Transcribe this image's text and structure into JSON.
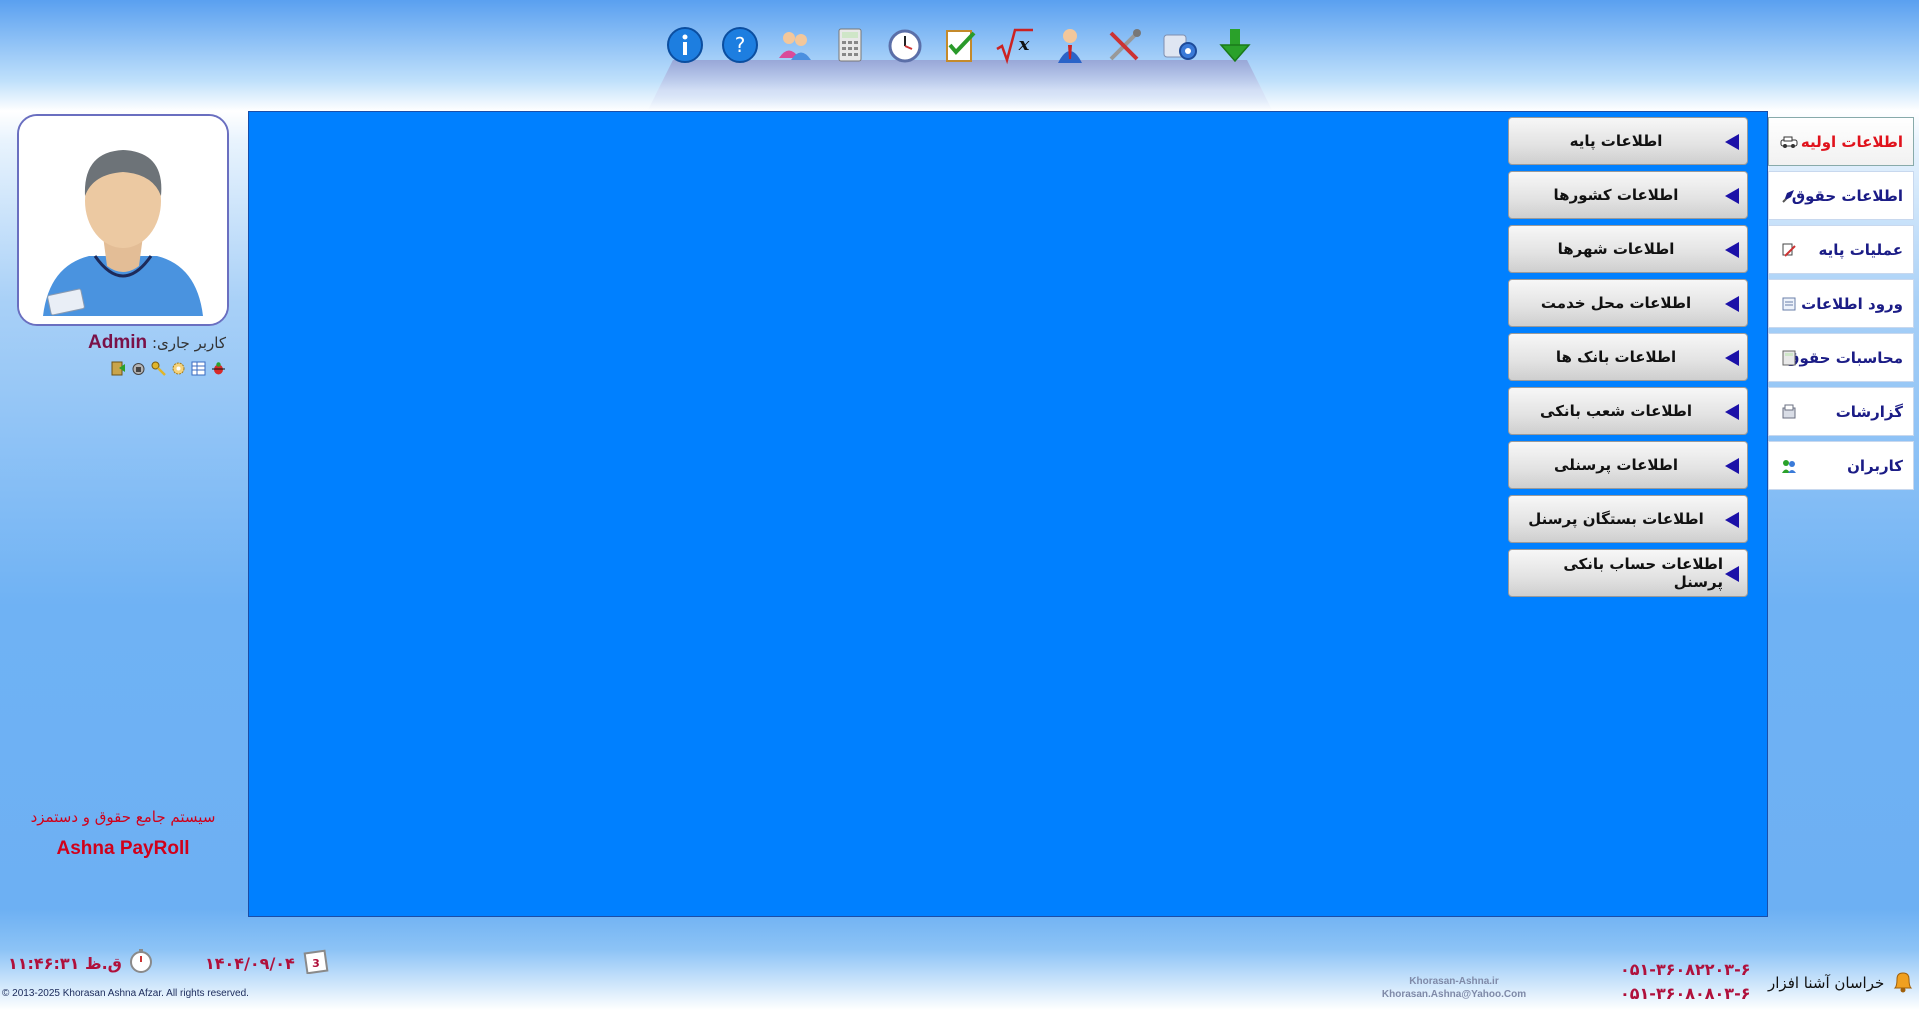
{
  "toolbar": {
    "icons": [
      "info-icon",
      "help-icon",
      "users-icon",
      "calculator-icon",
      "clock-icon",
      "checklist-icon",
      "sqrt-x-icon",
      "employee-icon",
      "tools-icon",
      "settings-icon",
      "download-arrow-icon"
    ]
  },
  "user": {
    "label": "کاربر جاری:",
    "name": "Admin"
  },
  "brand": {
    "title_fa": "سیستم جامع حقوق و دستمزد",
    "title_en": "Ashna PayRoll"
  },
  "main_menu": [
    {
      "label": "اطلاعات اولیه",
      "icon": "car-icon",
      "active": true
    },
    {
      "label": "اطلاعات حقوق",
      "icon": "pen-icon",
      "active": false
    },
    {
      "label": "عملیات پایه",
      "icon": "settings-tools-icon",
      "active": false
    },
    {
      "label": "ورود اطلاعات",
      "icon": "data-entry-icon",
      "active": false
    },
    {
      "label": "محاسبات حقوق",
      "icon": "calculator-small-icon",
      "active": false
    },
    {
      "label": "گزارشات",
      "icon": "report-icon",
      "active": false
    },
    {
      "label": "کاربران",
      "icon": "users-small-icon",
      "active": false
    }
  ],
  "sub_menu": [
    {
      "label": "اطلاعات پایه"
    },
    {
      "label": "اطلاعات کشورها"
    },
    {
      "label": "اطلاعات شهرها"
    },
    {
      "label": "اطلاعات محل خدمت"
    },
    {
      "label": "اطلاعات بانک ها"
    },
    {
      "label": "اطلاعات شعب بانکی"
    },
    {
      "label": "اطلاعات پرسنلی"
    },
    {
      "label": "اطلاعات بستگان پرسنل"
    },
    {
      "label": "اطلاعات حساب بانکی پرسنل"
    }
  ],
  "footer": {
    "time": "۱۱:۴۶:۳۱ ق.ظ",
    "date": "۱۴۰۴/۰۹/۰۴",
    "copyright": "© 2013-2025 Khorasan Ashna Afzar. All rights reserved.",
    "website": "Khorasan-Ashna.ir",
    "email": "Khorasan.Ashna@Yahoo.Com",
    "phone1": "۰۵۱-۳۶۰۸۲۲۰۳-۶",
    "phone2": "۰۵۱-۳۶۰۸۰۸۰۳-۶",
    "company": "خراسان آشنا افزار"
  },
  "colors": {
    "workspace": "#0080ff",
    "accent_red": "#d1001a",
    "menu_text": "#1b1c86",
    "arrow": "#1c11a8"
  }
}
